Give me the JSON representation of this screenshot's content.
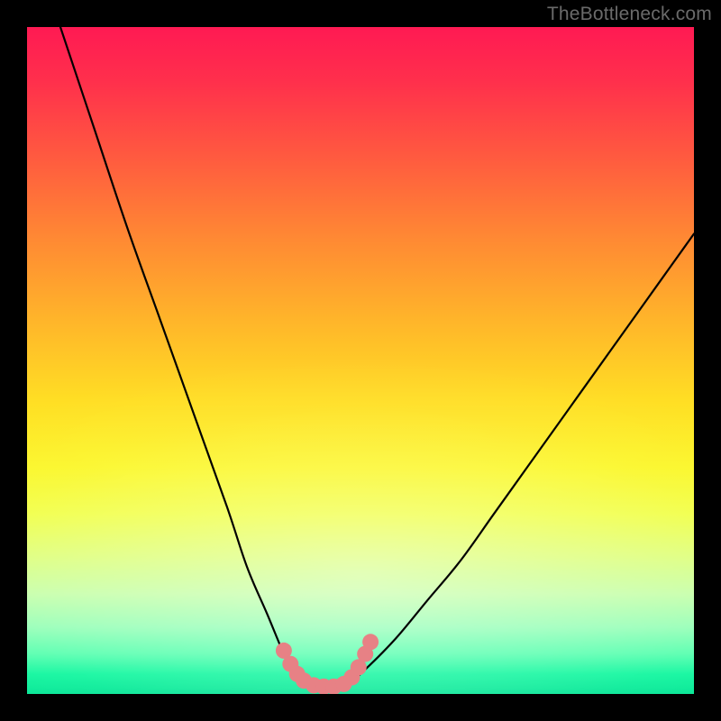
{
  "watermark": "TheBottleneck.com",
  "chart_data": {
    "type": "line",
    "title": "",
    "xlabel": "",
    "ylabel": "",
    "x_range": [
      0,
      100
    ],
    "y_range": [
      0,
      100
    ],
    "series": [
      {
        "name": "curve",
        "x": [
          5,
          10,
          15,
          20,
          25,
          30,
          33,
          36,
          38.5,
          40,
          42,
          44,
          46,
          48,
          50,
          55,
          60,
          65,
          70,
          75,
          80,
          85,
          90,
          95,
          100
        ],
        "y": [
          100,
          85,
          70,
          56,
          42,
          28,
          19,
          12,
          6,
          3,
          1.5,
          1,
          1,
          1.5,
          3,
          8,
          14,
          20,
          27,
          34,
          41,
          48,
          55,
          62,
          69
        ]
      }
    ],
    "markers": {
      "name": "highlight-band",
      "color": "#e78185",
      "points": [
        {
          "x": 38.5,
          "y": 6.5
        },
        {
          "x": 39.5,
          "y": 4.5
        },
        {
          "x": 40.5,
          "y": 3.0
        },
        {
          "x": 41.5,
          "y": 2.0
        },
        {
          "x": 43.0,
          "y": 1.3
        },
        {
          "x": 44.5,
          "y": 1.1
        },
        {
          "x": 46.0,
          "y": 1.1
        },
        {
          "x": 47.5,
          "y": 1.5
        },
        {
          "x": 48.7,
          "y": 2.5
        },
        {
          "x": 49.7,
          "y": 4.0
        },
        {
          "x": 50.7,
          "y": 6.0
        },
        {
          "x": 51.5,
          "y": 7.8
        }
      ]
    },
    "notes": "Curve descends from top-left, reaches a near-zero flat minimum around x≈42–48, then rises to the upper right. Pink markers outline the basin region near the minimum. Values estimated from pixel positions; no axis ticks or labels are present in the source image."
  }
}
